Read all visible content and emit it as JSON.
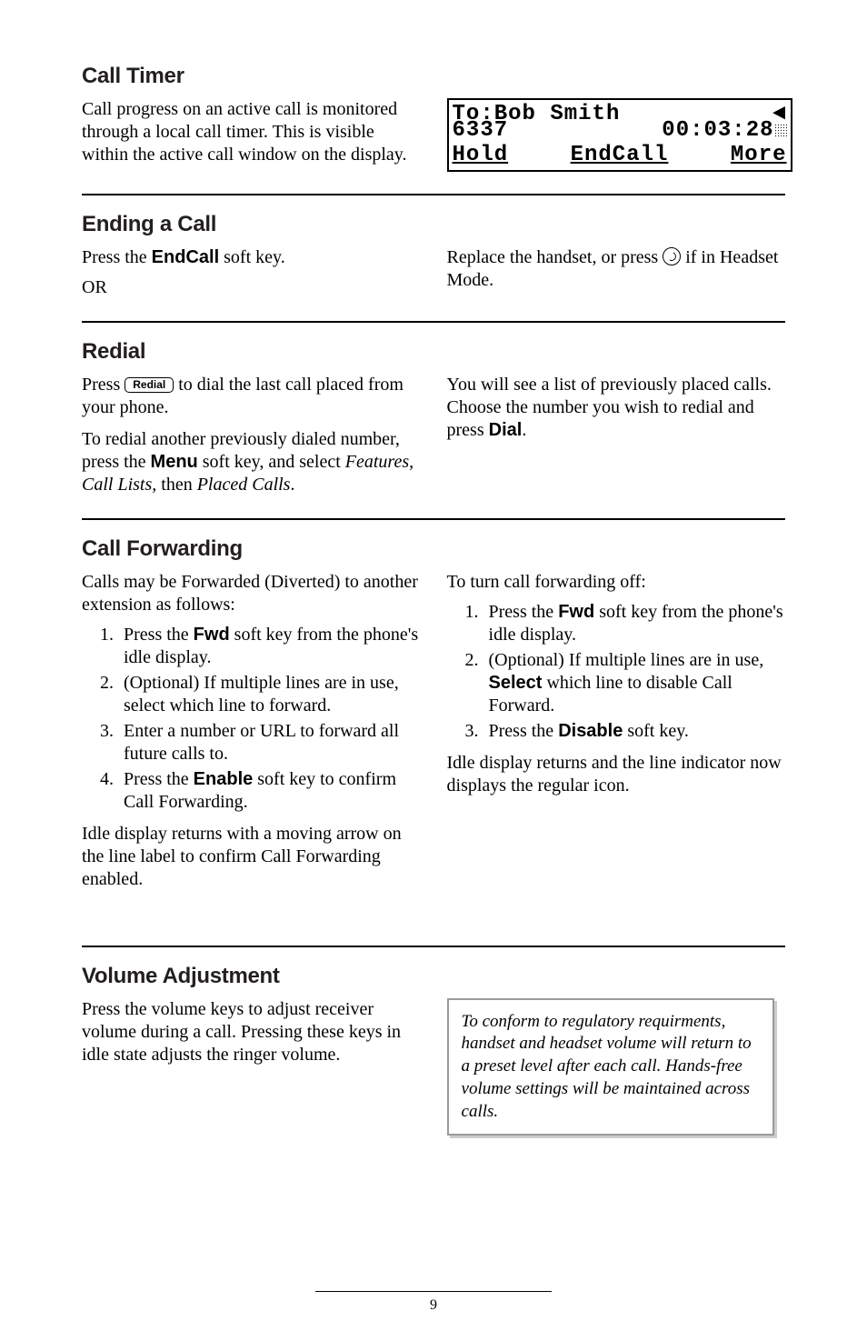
{
  "sections": {
    "callTimer": {
      "heading": "Call Timer",
      "body": "Call progress on an active call is monitored through a local call timer.  This is visible within the active call window on the display."
    },
    "lcd": {
      "line1_left": "To:Bob Smith",
      "line2_left": "6337",
      "line2_right": "00:03:28",
      "line3_left": "Hold",
      "line3_mid": "EndCall",
      "line3_right": "More"
    },
    "endingCall": {
      "heading": "Ending a Call",
      "leftPre": "Press the ",
      "endcall": "EndCall",
      "leftPost": " soft key.",
      "or": "OR",
      "rightPre": "Replace the handset, or press ",
      "rightPost": " if in Headset Mode."
    },
    "redial": {
      "heading": "Redial",
      "p1Pre": "Press ",
      "redialKey": "Redial",
      "p1Post": " to dial the last call placed from your phone.",
      "p2Pre": "To redial another previously dialed number, press the ",
      "menu": "Menu",
      "p2Mid": " soft key, and select ",
      "p2Italic": "Features, Call Lists,",
      "p2Then": " then ",
      "p2Italic2": "Placed Calls",
      "p2End": ".",
      "rightPre": "You will see a list of previously placed calls.  Choose the number you wish to redial and press ",
      "dial": "Dial",
      "rightEnd": "."
    },
    "callFwd": {
      "heading": "Call Forwarding",
      "intro": "Calls may be Forwarded (Diverted) to another extension as follows:",
      "on": {
        "i1Pre": "Press the ",
        "fwd": "Fwd",
        "i1Post": " soft key from the phone's idle display.",
        "i2": "(Optional) If multiple lines are in use, select which line to forward.",
        "i3": "Enter a number or URL to forward all future calls to.",
        "i4Pre": "Press the ",
        "enable": "Enable",
        "i4Post": " soft key to confirm Call Forwarding."
      },
      "onAfter": "Idle display returns with a moving arrow on the line label to confirm Call Forwarding enabled.",
      "offIntro": "To turn call forwarding off:",
      "off": {
        "i1Pre": "Press the ",
        "fwd": "Fwd",
        "i1Post": " soft key from the phone's idle display.",
        "i2Pre": "(Optional) If multiple lines are in use, ",
        "select": "Select",
        "i2Post": " which line to disable Call Forward.",
        "i3Pre": "Press the ",
        "disable": "Disable",
        "i3Post": " soft key."
      },
      "offAfter": "Idle display returns and the line indicator now displays the regular icon."
    },
    "volume": {
      "heading": "Volume Adjustment",
      "body": "Press the volume keys to adjust receiver volume during a call.  Pressing these keys in idle state adjusts the ringer volume.",
      "note": "To conform to regulatory requirments, handset and headset volume will return to a preset level after each call.  Hands-free volume settings will be maintained across calls."
    }
  },
  "pageNumber": "9"
}
